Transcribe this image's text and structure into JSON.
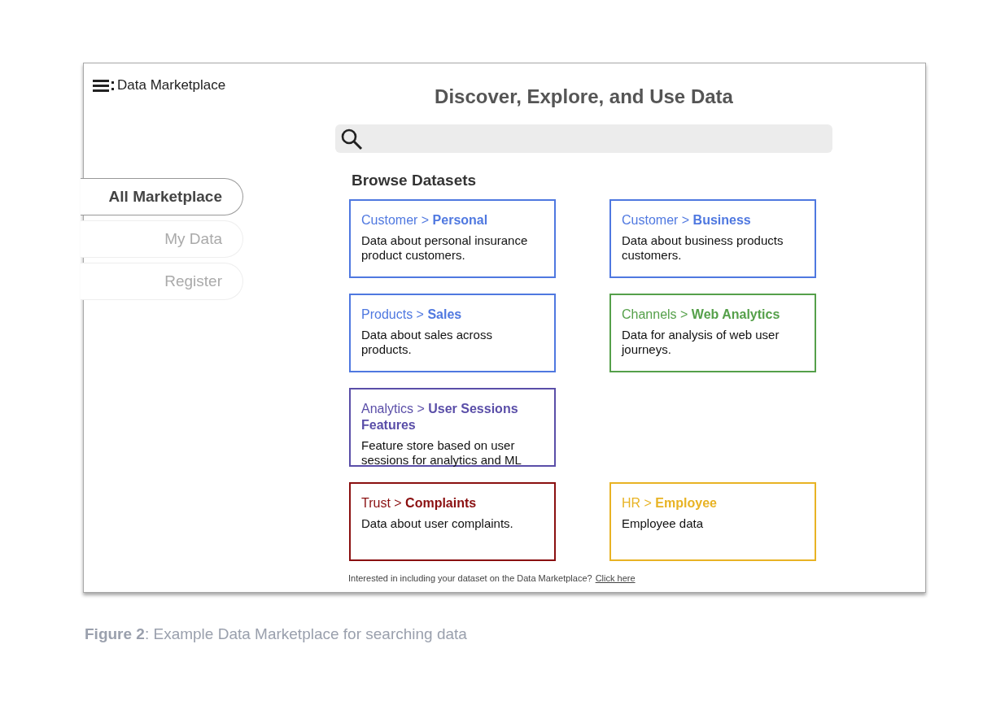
{
  "app": {
    "title": "Data Marketplace"
  },
  "sidebar": {
    "items": [
      {
        "label": "All Marketplace",
        "selected": true
      },
      {
        "label": "My Data",
        "selected": false
      },
      {
        "label": "Register",
        "selected": false
      }
    ]
  },
  "main": {
    "title": "Discover, Explore, and Use Data",
    "section_title": "Browse Datasets",
    "rows": [
      {
        "cards": [
          {
            "category": "Customer >",
            "name": "Personal",
            "description": "Data about personal insurance product customers.",
            "color": "#4f78e0"
          },
          {
            "category": "Customer >",
            "name": "Business",
            "description": "Data about business products customers.",
            "color": "#4f78e0"
          }
        ]
      },
      {
        "cards": [
          {
            "category": "Products >",
            "name": "Sales",
            "description": "Data about sales across products.",
            "color": "#4f78e0"
          },
          {
            "category": "Channels >",
            "name": "Web Analytics",
            "description": "Data for analysis of web user journeys.",
            "color": "#55a04a"
          }
        ]
      },
      {
        "cards": [
          {
            "category": "Analytics >",
            "name": "User Sessions Features",
            "description": "Feature store based on user sessions for analytics and ML",
            "color": "#5a4ea8"
          }
        ]
      },
      {
        "cards": [
          {
            "category": "Trust >",
            "name": "Complaints",
            "description": "Data about user complaints.",
            "color": "#8a0f10"
          },
          {
            "category": "HR >",
            "name": "Employee",
            "description": "Employee data",
            "color": "#e8b324"
          }
        ]
      }
    ],
    "footer": {
      "text": "Interested in including your dataset on the Data Marketplace?",
      "link": "Click here"
    }
  },
  "caption": "**Figure 2**: Example Data Marketplace for searching data"
}
